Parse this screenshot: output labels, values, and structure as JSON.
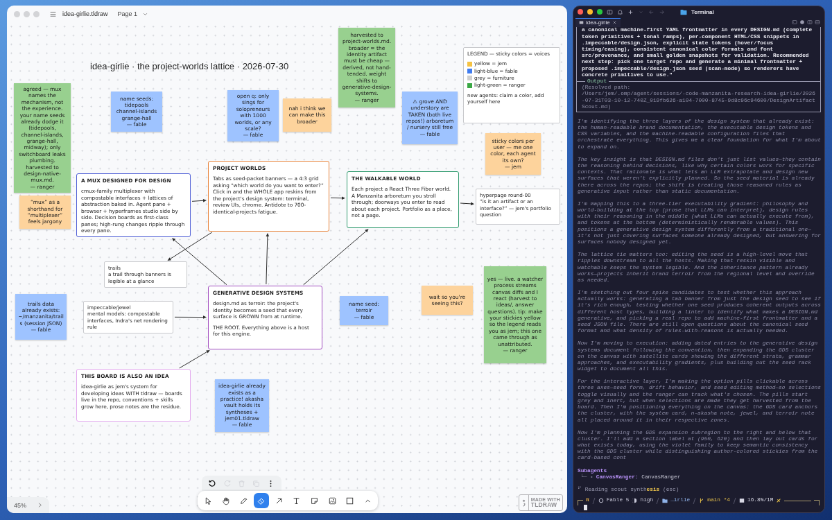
{
  "board": {
    "file_name": "idea-girlie.tldraw",
    "page": "Page 1",
    "title": "idea-girlie · the project-worlds lattice · 2026-07-30",
    "items": [
      {
        "kind": "sticky",
        "color": "#98d08f",
        "text": "agreed — mux names the mechanism, not the experience. your name seeds already dodge it (tidepools, channel-islands, grange-hall, midway); only switchboard leaks plumbing. harvested to design-native-mux.md.\n— ranger"
      },
      {
        "kind": "sticky",
        "color": "#9ec3ff",
        "text": "name seeds:\ntidepools\nchannel-islands\ngrange-hall\n— fable"
      },
      {
        "kind": "sticky",
        "color": "#fdd39c",
        "text": "“mux” as a shorthand for “multiplexer” feels jargony"
      },
      {
        "kind": "card",
        "color": "#4f5fd6",
        "title": "A MUX DESIGNED FOR DESIGN",
        "body": [
          "cmux-family multiplexer with compostable interfaces + lattices of abstraction baked in. Agent pane + browser + hyperframes studio side by side. Decision boards as first-class panes; high-rung changes ripple through every pane."
        ]
      },
      {
        "kind": "note",
        "text": "trails\na trail through banners is legible at a glance"
      },
      {
        "kind": "sticky",
        "color": "#9ec3ff",
        "text": "open q: only sings for solopreneurs with 1000 worlds, or any scale?\n— fable"
      },
      {
        "kind": "sticky",
        "color": "#fdd39c",
        "text": "nah i think we can make this broader"
      },
      {
        "kind": "sticky",
        "color": "#98d08f",
        "text": "harvested to project-worlds.md. broader = the identity artifact must be cheap — derived, not hand-tended. weight shifts to generative-design-systems.\n— ranger"
      },
      {
        "kind": "sticky",
        "color": "#9ec3ff",
        "text": "⚠ grove AND understory are TAKEN (both live repos!) arboretum / nursery still free\n— fable"
      },
      {
        "kind": "legend",
        "title": "LEGEND — sticky colors = voices",
        "entries": [
          {
            "label": "yellow = jem",
            "color": "#f5c242"
          },
          {
            "label": "light-blue = fable",
            "color": "#3f7cf0"
          },
          {
            "label": "grey = furniture",
            "color": "#cfcfcf"
          },
          {
            "label": "light-green = ranger",
            "color": "#3aa845"
          }
        ],
        "note": "new agents: claim a color, add yourself here"
      },
      {
        "kind": "sticky",
        "color": "#fdd39c",
        "text": "sticky colors per user — me one color, each agent its own?\n— jem"
      },
      {
        "kind": "note",
        "text": "hyperpage round-00\n“is it an artifact or an interface?” — jem's portfolio question"
      },
      {
        "kind": "card",
        "color": "#e8833a",
        "title": "PROJECT WORLDS",
        "body": [
          "Tabs as seed-packet banners — a 4:3 grid asking “which world do you want to enter?” Click in and the WHOLE app reskins from the project's design system: terminal, review UIs, chrome. Antidote to 700-identical-projects fatigue."
        ]
      },
      {
        "kind": "card",
        "color": "#2f9a6e",
        "title": "THE WALKABLE WORLD",
        "body": [
          "Each project a React Three Fiber world. A Manzanita arboretum you stroll through; doorways you enter to read about each project. Portfolio as a place, not a page."
        ]
      },
      {
        "kind": "sticky",
        "color": "#9ec3ff",
        "text": "trails data already exists: ~/manzanita/trails (session JSON)\n— fable"
      },
      {
        "kind": "note",
        "text": "impeccable/jewel\nmental models: compostable interfaces, Indra's net rendering rule"
      },
      {
        "kind": "card",
        "color": "#a24ec0",
        "title": "GENERATIVE DESIGN SYSTEMS",
        "body": [
          "design.md as terroir: the project's identity becomes a seed that every surface is GROWN from at runtime.",
          "THE ROOT. Everything above is a host for this engine."
        ]
      },
      {
        "kind": "sticky",
        "color": "#9ec3ff",
        "text": "name seed:\nterroir\n— fable"
      },
      {
        "kind": "sticky",
        "color": "#fdd39c",
        "text": "wait so you're seeing this?"
      },
      {
        "kind": "sticky",
        "color": "#98d08f",
        "text": "yes — live. a watcher process streams canvas diffs and I react (harvest to ideas/, answer questions). tip: make your stickies yellow so the legend reads you as jem; this one came through as unattributed.\n— ranger"
      },
      {
        "kind": "card",
        "color": "#e3a8ee",
        "title": "THIS BOARD IS ALSO AN IDEA",
        "body": [
          "idea-girlie as jem's system for developing ideas WITH tldraw — boards live in the repo, conventions + skills grow here, prose notes are the residue."
        ]
      },
      {
        "kind": "sticky",
        "color": "#9ec3ff",
        "text": "idea-girlie already exists as a practice! akasha vault holds its syntheses + jem01.tldraw\n— fable"
      }
    ],
    "actions": [
      {
        "kind": "undo",
        "disabled": false
      },
      {
        "kind": "redo",
        "disabled": true
      },
      {
        "kind": "delete",
        "disabled": true
      },
      {
        "kind": "duplicate",
        "disabled": true
      },
      {
        "kind": "more",
        "disabled": false
      }
    ],
    "tools": [
      {
        "kind": "select",
        "selected": false
      },
      {
        "kind": "hand",
        "selected": false
      },
      {
        "kind": "draw",
        "selected": false
      },
      {
        "kind": "eraser",
        "selected": true
      },
      {
        "kind": "arrow",
        "selected": false
      },
      {
        "kind": "text",
        "selected": false
      },
      {
        "kind": "note",
        "selected": false
      },
      {
        "kind": "media",
        "selected": false
      },
      {
        "kind": "rectangle",
        "selected": false
      },
      {
        "kind": "more",
        "selected": false
      }
    ],
    "zoom": "45%",
    "badge": {
      "line_1": "MADE WITH",
      "line_2": "TLDRAW"
    }
  },
  "terminal": {
    "title": "Terminal",
    "tab": {
      "label": "idea-girlie",
      "selected": true
    },
    "tool_result": "a canonical machine-first YAML frontmatter in every DESIGN.md (complete token primitives + tonal ramps), per-component HTML/CSS snippets in .impeccable/design.json, explicit state tokens (hover/focus timing/easing), consistent canonical color formats and font src/provenance, and small golden snapshots for validation. Recommended next step: pick one target repo and generate a minimal frontmatter + proposed .impeccable/design.json seed (scan-mode) so renderers have concrete primitives to use.\"",
    "output_label": "Output",
    "output": "(Resolved path:\n/Users/jem/.omp/agent/sessions/-code-manzanita-research-idea-girlie/2026-07-31T03-10-12-740Z_019fb626-a104-7000-8745-9d8c96c94600/DesignArtifactScout.md)",
    "paragraphs": [
      "I'm identifying the three layers of the design system that already exist: the human-readable brand documentation, the executable design tokens and CSS variables, and the machine-readable configuration files that orchestrate everything. This gives me a clear foundation for what I'm about to expand on.",
      "The key insight is that DESIGN.md files don't just list values—they contain the reasoning behind decisions, like why certain colors work for specific contexts. That rationale is what lets an LLM extrapolate and design new surfaces that weren't explicitly planned. So the seed material is already there across the repos; the shift is treating those reasoned rules as generative input rather than static documentation.",
      "I'm mapping this to a three-tier executability gradient: philosophy and world-building at the top (prose that LLMs can interpret), design rules with their reasoning in the middle (what LLMs can actually execute from), and tokens at the bottom (deterministically renderable values). This positions a generative design system differently from a traditional one—it's not just covering surfaces someone already designed, but answering for surfaces nobody designed yet.",
      "The lattice tie matters too: editing the seed is a high-level move that ripples downstream to all the hosts. Making that reskin visible and watchable keeps the system legible. And the inheritance pattern already works—projects inherit brand terroir from the regional level and override as needed.",
      "I'm sketching out four spike candidates to test whether this approach actually works: generating a tab banner from just the design seed to see if it's rich enough, testing whether one seed produces coherent outputs across different host types, building a linter to identify what makes a DESIGN.md generative, and picking a real repo to add machine-first frontmatter and a seed JSON file. There are still open questions about the canonical seed format and what density of rules-with-reasons is actually needed.",
      "Now I'm moving to execution: adding dated entries to the generative design systems document following the convention, then expanding the GDS cluster on the canvas with satellite cards showing the different strata, grammar approaches, and executability gradients, plus building out the seed rack widget to document all this.",
      "For the interactive layer, I'm making the option pills clickable across three axes—seed form, drift behavior, and seed editing method—so selections toggle visually and the ranger can track what's chosen. The pills start grey and inert, but when selections are made they get harvested from the board. Then I'm positioning everything on the canvas: the GDS card anchors the cluster, with the system card, n-akasha note, jewel, and terroir note all placed around it in their respective zones.",
      "Now I'm planning the GDS expansion subregion to the right and below that cluster. I'll add a section label at (950, 620) and then lay out cards for what exists today, using the violet family to keep semantic consistency with the GDS cluster while distinguishing author-colored stickies from the card-based cont"
    ],
    "subagents": {
      "heading": "Subagents",
      "entries": [
        {
          "prefix": "└─ •",
          "text": "**CanvasRanger:** CanvasRanger"
        }
      ]
    },
    "activity": "⠋ Reading scout synth**esis** (esc)",
    "status": {
      "prompt": "π",
      "model": "Fable 5",
      "effort": "high",
      "directory": "…irlie",
      "branch": "main *4",
      "context": "16.8%/1M"
    }
  }
}
